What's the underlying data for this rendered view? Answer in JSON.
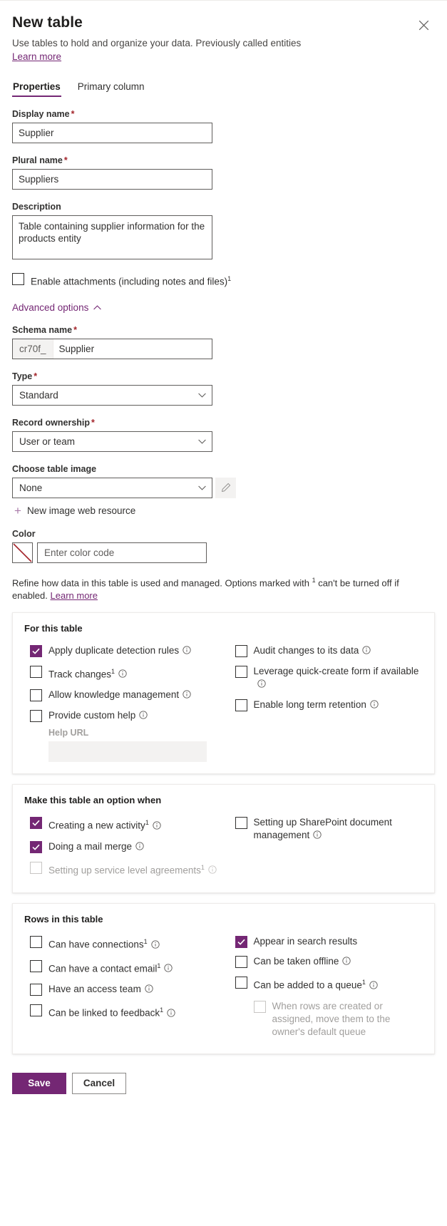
{
  "header": {
    "title": "New table",
    "subtitle": "Use tables to hold and organize your data. Previously called entities",
    "learn_more": "Learn more",
    "close_label": "Close"
  },
  "tabs": [
    {
      "label": "Properties",
      "active": true
    },
    {
      "label": "Primary column",
      "active": false
    }
  ],
  "form": {
    "display_name": {
      "label": "Display name",
      "required": true,
      "value": "Supplier"
    },
    "plural_name": {
      "label": "Plural name",
      "required": true,
      "value": "Suppliers"
    },
    "description": {
      "label": "Description",
      "required": false,
      "value": "Table containing supplier information for the products entity"
    },
    "enable_attachments": {
      "label": "Enable attachments (including notes and files)",
      "footnote": "1",
      "checked": false
    },
    "advanced_options": {
      "label": "Advanced options",
      "expanded": true
    },
    "schema_name": {
      "label": "Schema name",
      "required": true,
      "prefix": "cr70f_",
      "value": "Supplier"
    },
    "type": {
      "label": "Type",
      "required": true,
      "value": "Standard"
    },
    "record_ownership": {
      "label": "Record ownership",
      "required": true,
      "value": "User or team"
    },
    "table_image": {
      "label": "Choose table image",
      "value": "None"
    },
    "new_image_web_resource": "New image web resource",
    "color": {
      "label": "Color",
      "placeholder": "Enter color code",
      "value": ""
    }
  },
  "refine_note": {
    "text_before": "Refine how data in this table is used and managed. Options marked with ",
    "footnote": "1",
    "text_after": " can't be turned off if enabled. ",
    "link": "Learn more"
  },
  "cards": [
    {
      "title": "For this table",
      "left": [
        {
          "label": "Apply duplicate detection rules",
          "checked": true,
          "footnote": "",
          "info": true,
          "disabled": false
        },
        {
          "label": "Track changes",
          "checked": false,
          "footnote": "1",
          "info": true,
          "disabled": false
        },
        {
          "label": "Allow knowledge management",
          "checked": false,
          "footnote": "",
          "info": true,
          "disabled": false
        },
        {
          "label": "Provide custom help",
          "checked": false,
          "footnote": "",
          "info": true,
          "disabled": false
        }
      ],
      "help_url": {
        "label": "Help URL",
        "value": "",
        "disabled": true
      },
      "right": [
        {
          "label": "Audit changes to its data",
          "checked": false,
          "footnote": "",
          "info": true,
          "disabled": false
        },
        {
          "label": "Leverage quick-create form if available",
          "checked": false,
          "footnote": "",
          "info": true,
          "disabled": false
        },
        {
          "label": "Enable long term retention",
          "checked": false,
          "footnote": "",
          "info": true,
          "disabled": false
        }
      ]
    },
    {
      "title": "Make this table an option when",
      "left": [
        {
          "label": "Creating a new activity",
          "checked": true,
          "footnote": "1",
          "info": true,
          "disabled": false
        },
        {
          "label": "Doing a mail merge",
          "checked": true,
          "footnote": "",
          "info": true,
          "disabled": false
        },
        {
          "label": "Setting up service level agreements",
          "checked": false,
          "footnote": "1",
          "info": true,
          "disabled": true
        }
      ],
      "right": [
        {
          "label": "Setting up SharePoint document management",
          "checked": false,
          "footnote": "",
          "info": true,
          "disabled": false
        }
      ]
    },
    {
      "title": "Rows in this table",
      "left": [
        {
          "label": "Can have connections",
          "checked": false,
          "footnote": "1",
          "info": true,
          "disabled": false
        },
        {
          "label": "Can have a contact email",
          "checked": false,
          "footnote": "1",
          "info": true,
          "disabled": false
        },
        {
          "label": "Have an access team",
          "checked": false,
          "footnote": "",
          "info": true,
          "disabled": false
        },
        {
          "label": "Can be linked to feedback",
          "checked": false,
          "footnote": "1",
          "info": true,
          "disabled": false
        }
      ],
      "right": [
        {
          "label": "Appear in search results",
          "checked": true,
          "footnote": "",
          "info": false,
          "disabled": false
        },
        {
          "label": "Can be taken offline",
          "checked": false,
          "footnote": "",
          "info": true,
          "disabled": false
        },
        {
          "label": "Can be added to a queue",
          "checked": false,
          "footnote": "1",
          "info": true,
          "disabled": false
        },
        {
          "label": "When rows are created or assigned, move them to the owner's default queue",
          "checked": false,
          "footnote": "",
          "info": false,
          "disabled": true,
          "indent": true
        }
      ]
    }
  ],
  "footer": {
    "save": "Save",
    "cancel": "Cancel"
  },
  "colors": {
    "accent": "#742774",
    "required": "#a4262c",
    "swatch_slash": "#a4262c"
  }
}
